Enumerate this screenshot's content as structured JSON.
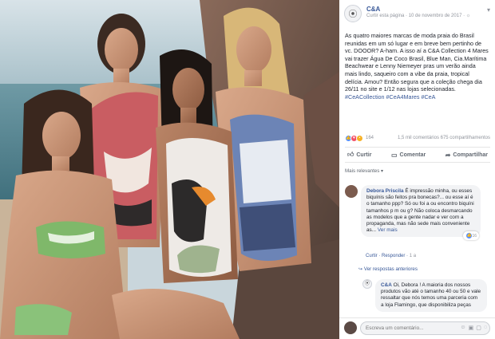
{
  "post": {
    "page_name": "C&A",
    "meta": "Curtir esta página · 10 de novembro de 2017 · ☼",
    "body_text": "As quatro maiores marcas de moda praia do Brasil reunidas em um só lugar e em breve bem pertinho de vc. DOOOR? A-ham. A isso aí a C&A Collection 4 Mares vai trazer Água De Coco Brasil, Blue Man, Cia.Marítima Beachwear e Lenny Niemeyer pras um verão ainda mais lindo, saqueiro com a vibe da praia, tropical delícia. Amou? Então segura que a coleção chega dia 26/11 no site e 1/12 nas lojas selecionadas.",
    "hashtags": "#CeACollection #CeA4Mares #CeA"
  },
  "reactions": {
    "count": "164",
    "stats": "1,5 mil comentários  675 compartilhamentos"
  },
  "actions": {
    "like": "Curtir",
    "comment": "Comentar",
    "share": "Compartilhar"
  },
  "relevance_label": "Mais relevantes ▾",
  "comment1": {
    "author": "Debora Priscila",
    "text": "É impressão minha, ou esses biquínis são feitos pra bonecas?... ou esse aí é o tamanho ppp? Só ou foi a ou encontro biquíni tamanhos p m ou g? Não coloca desmarcando as modelos que a gente nadar e ver com a propaganda, mas não sede mais conveniente as...",
    "more": "Ver mais",
    "react_count": "16",
    "like_action": "Curtir",
    "reply_action": "Responder",
    "time": "1 a"
  },
  "see_replies": "↪ Ver respostas anteriores",
  "reply1": {
    "author": "C&A",
    "text": "Oi, Debora ! A maioria dos nossos produtos vão até o tamanho 40 ou 50 e vale ressaltar que nós temos uma parceria com a loja Flamingo, que disponibiliza peças"
  },
  "composer": {
    "placeholder": "Escreva um comentário..."
  },
  "icons": {
    "page_avatar": "ca-logo-icon",
    "more": "chevron-down-icon",
    "like": "thumbs-up-icon",
    "comment": "speech-bubble-icon",
    "share": "share-arrow-icon",
    "emoji": "emoji-icon",
    "camera": "camera-icon"
  },
  "colors": {
    "link": "#385898",
    "like_blue": "#5890ff",
    "love_red": "#f25268"
  }
}
